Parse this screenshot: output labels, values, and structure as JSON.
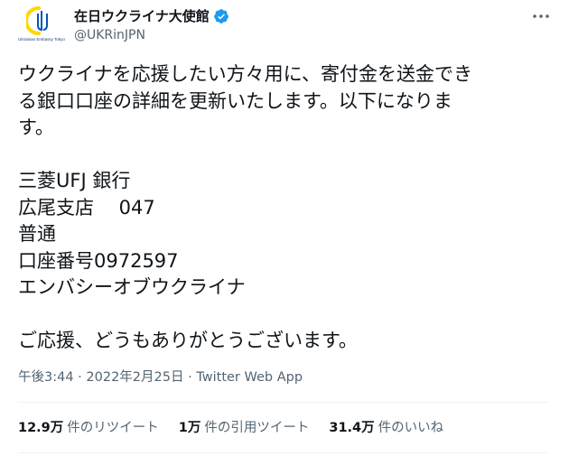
{
  "author": {
    "display_name": "在日ウクライナ大使館",
    "handle": "@UKRinJPN",
    "avatar_caption": "Ukrainian Embassy Tokyo",
    "verified": true
  },
  "tweet": {
    "lines": [
      "ウクライナを応援したい方々用に、寄付金を送金でき",
      "る銀口口座の詳細を更新いたします。以下になりま",
      "す。",
      "",
      "三菱UFJ 銀行",
      "広尾支店　 047",
      "普通",
      "口座番号0972597",
      "エンバシーオブウクライナ",
      "",
      "ご応援、どうもありがとうございます。"
    ]
  },
  "meta": {
    "time": "午後3:44",
    "separator": "·",
    "date": "2022年2月25日",
    "source": "Twitter Web App"
  },
  "stats": [
    {
      "count": "12.9万",
      "label": "件のリツイート"
    },
    {
      "count": "1万",
      "label": "件の引用ツイート"
    },
    {
      "count": "31.4万",
      "label": "件のいいね"
    }
  ],
  "icons": {
    "verified": "verified-badge-icon",
    "more": "more-options-icon",
    "avatar": "ukraine-trident-logo"
  },
  "colors": {
    "text_primary": "#0f1419",
    "text_secondary": "#536471",
    "verified_blue": "#1d9bf0",
    "ukraine_blue": "#0057b7",
    "ukraine_yellow": "#ffd700",
    "divider": "#eff3f4"
  }
}
